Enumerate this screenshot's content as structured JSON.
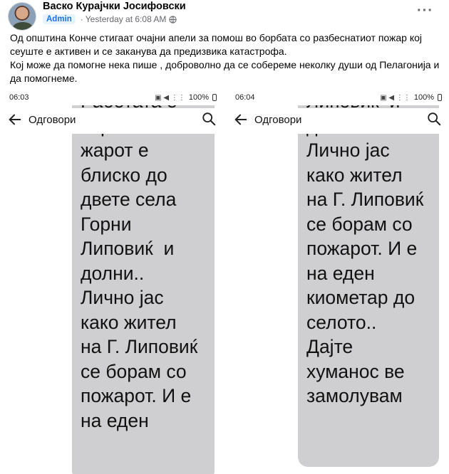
{
  "post": {
    "author": "Васко Курајчки Јосифовски",
    "role_badge": "Admin",
    "separator": "·",
    "timestamp": "Yesterday at 6:08 AM",
    "more_label": "···",
    "text_line_1": "Од општина Конче стигаат очајни апели за помош во борбата со разбеснатиот пожар кој сеуште е активен и се заканува да предизвика катастрофа.",
    "text_line_2": "Кој може да помогне нека пише , доброволно да се собереме неколку души од Пелагонија и да помогнеме."
  },
  "screenshots": [
    {
      "status_time": "06:03",
      "battery": "100%",
      "app_title": "Одговори",
      "message_text": "Работата е\nсириозна..По\nжарот е\nблиско до\nдвете села\nГорни\nЛиповиќ  и\nдолни..\nЛично јас\nкако жител\nна Г. Липовиќ\nсе борам со\nпожарот. И е\nна еден"
    },
    {
      "status_time": "06:04",
      "battery": "100%",
      "app_title": "Одговори",
      "message_text": "Липовиќ  и\nдолни..\nЛично јас\nкако жител\nна Г. Липовиќ\nсе борам со\nпожарот. И е\nна еден\nкиометар до\nселото..\nДајте\nхуманос ве\nзамолувам"
    }
  ],
  "icons": {
    "back": "back-arrow-icon",
    "search": "search-icon",
    "globe": "globe-icon",
    "battery": "battery-icon"
  },
  "colors": {
    "badge_bg": "#e7f3ff",
    "badge_text": "#1b74e4",
    "bubble": "#cfcfd1",
    "meta_text": "#65676b"
  }
}
